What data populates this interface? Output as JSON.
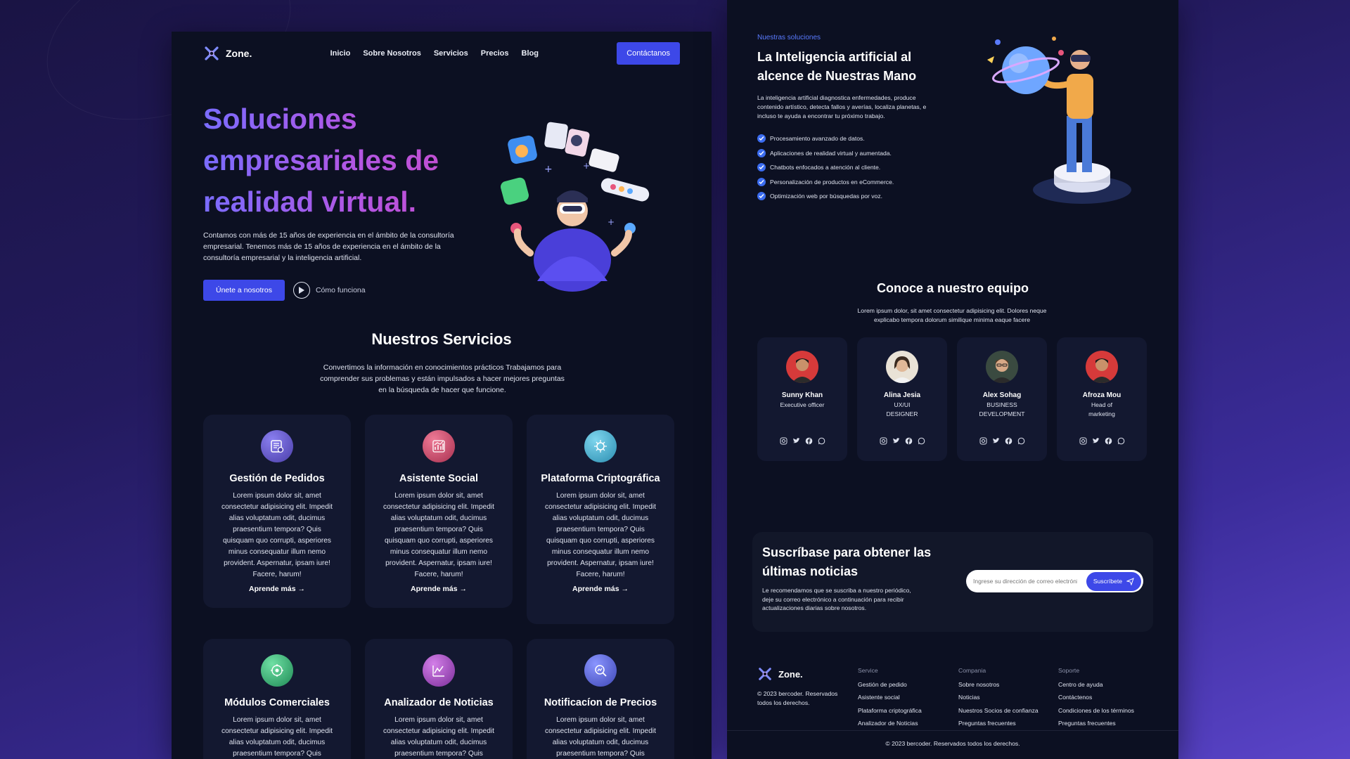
{
  "nav": {
    "brand": "Zone.",
    "links": [
      "Inicio",
      "Sobre Nosotros",
      "Servicios",
      "Precios",
      "Blog"
    ],
    "cta": "Contáctanos"
  },
  "hero": {
    "title": "Soluciones empresariales de realidad virtual.",
    "text": "Contamos con más de 15 años de experiencia en el ámbito de la consultoría empresarial. Tenemos más de 15 años de experiencia en el ámbito de la consultoría empresarial y la inteligencia artificial.",
    "primary_button": "Únete a nosotros",
    "secondary_link": "Cómo funciona"
  },
  "services": {
    "title": "Nuestros Servicios",
    "subtitle": "Convertimos la información en conocimientos prácticos Trabajamos para comprender sus problemas y están impulsados a hacer mejores preguntas en la búsqueda de hacer que funcione.",
    "cards": [
      {
        "title": "Gestión de Pedidos",
        "text": "Lorem ipsum dolor sit, amet consectetur adipisicing elit. Impedit alias voluptatum odit, ducimus praesentium tempora? Quis quisquam quo corrupti, asperiores minus consequatur illum nemo provident. Aspernatur, ipsam iure! Facere, harum!",
        "link": "Aprende más →",
        "icon": "order-list-icon",
        "color": "#5b4fb3"
      },
      {
        "title": "Asistente Social",
        "text": "Lorem ipsum dolor sit, amet consectetur adipisicing elit. Impedit alias voluptatum odit, ducimus praesentium tempora? Quis quisquam quo corrupti, asperiores minus consequatur illum nemo provident. Aspernatur, ipsam iure! Facere, harum!",
        "link": "Aprende más →",
        "icon": "chart-icon",
        "color": "#c2456b"
      },
      {
        "title": "Plataforma Criptográfica",
        "text": "Lorem ipsum dolor sit, amet consectetur adipisicing elit. Impedit alias voluptatum odit, ducimus praesentium tempora? Quis quisquam quo corrupti, asperiores minus consequatur illum nemo provident. Aspernatur, ipsam iure! Facere, harum!",
        "link": "Aprende más →",
        "icon": "crypto-icon",
        "color": "#3fa8c8"
      },
      {
        "title": "Módulos Comerciales",
        "text": "Lorem ipsum dolor sit, amet consectetur adipisicing elit. Impedit alias voluptatum odit, ducimus praesentium tempora? Quis",
        "icon": "modules-icon",
        "color": "#2fa56c"
      },
      {
        "title": "Analizador de Noticias",
        "text": "Lorem ipsum dolor sit, amet consectetur adipisicing elit. Impedit alias voluptatum odit, ducimus praesentium tempora? Quis",
        "icon": "news-chart-icon",
        "color": "#9c47b8"
      },
      {
        "title": "Notificacíon de Precios",
        "text": "Lorem ipsum dolor sit, amet consectetur adipisicing elit. Impedit alias voluptatum odit, ducimus praesentium tempora? Quis",
        "icon": "price-search-icon",
        "color": "#5462d6"
      }
    ]
  },
  "solutions": {
    "kicker": "Nuestras soluciones",
    "title": "La Inteligencia artificial al alcence de Nuestras Mano",
    "text": "La inteligencia artificial diagnostica enfermedades, produce contenido artístico, detecta fallos y averías, localiza planetas, e incluso te ayuda a encontrar tu próximo trabajo.",
    "items": [
      "Procesamiento avanzado de datos.",
      "Aplicaciones de realidad virtual y aumentada.",
      "Chatbots enfocados a atención al cliente.",
      "Personalización de productos en eCommerce.",
      "Optimización web por búsquedas por voz."
    ]
  },
  "team": {
    "title": "Conoce a nuestro equipo",
    "subtitle": "Lorem ipsum dolor, sit amet consectetur adipisicing elit. Dolores neque explicabo tempora dolorum similique minima eaque facere",
    "members": [
      {
        "name": "Sunny Khan",
        "role": "Executive officer"
      },
      {
        "name": "Alina Jesia",
        "role": "UX/UI DESIGNER"
      },
      {
        "name": "Alex Sohag",
        "role": "BUSINESS DEVELOPMENT"
      },
      {
        "name": "Afroza Mou",
        "role": "Head of marketing"
      }
    ]
  },
  "subscribe": {
    "title": "Suscríbase para obtener las últimas noticias",
    "text": "Le recomendamos que se suscriba a nuestro periódico, deje su correo electrónico a continuación para recibir actualizaciones diarias sobre nosotros.",
    "placeholder": "Ingrese su dirección de correo electrónico",
    "button": "Suscríbete"
  },
  "footer": {
    "brand": "Zone.",
    "copy": "© 2023 bercoder. Reservados todos los derechos.",
    "columns": [
      {
        "heading": "Service",
        "links": [
          "Gestión de pedido",
          "Asistente social",
          "Plataforma criptográfica",
          "Analizador de Noticias"
        ]
      },
      {
        "heading": "Compania",
        "links": [
          "Sobre nosotros",
          "Noticias",
          "Nuestros Socios de confianza",
          "Preguntas frecuentes"
        ]
      },
      {
        "heading": "Soporte",
        "links": [
          "Centro de ayuda",
          "Contáctenos",
          "Condiciones de los términos",
          "Preguntas frecuentes"
        ]
      }
    ],
    "bottom": "© 2023 bercoder. Reservados todos los derechos."
  }
}
